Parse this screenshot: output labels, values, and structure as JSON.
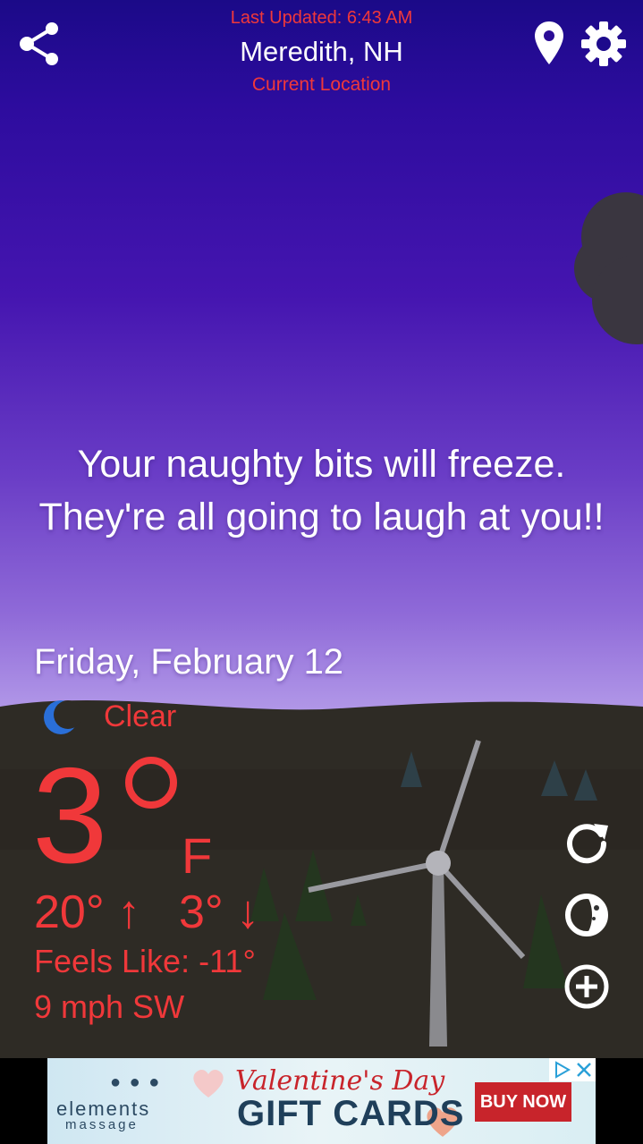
{
  "header": {
    "last_updated": "Last Updated: 6:43 AM",
    "city": "Meredith, NH",
    "location_label": "Current Location"
  },
  "icons": {
    "share": "share-icon",
    "location": "map-pin-icon",
    "settings": "gear-icon",
    "condition": "crescent-moon-icon",
    "refresh": "refresh-icon",
    "radar": "radar-icon",
    "add": "plus-circle-icon"
  },
  "message": "Your naughty bits will freeze. They're all going to laugh at you!!",
  "weather": {
    "date": "Friday, February 12",
    "condition": "Clear",
    "temperature": "3",
    "unit": "F",
    "high": "20° ↑",
    "low": "3° ↓",
    "feels_like": "Feels Like: -11°",
    "wind": "9 mph SW"
  },
  "ad": {
    "brand": "elements",
    "brand_sub": "massage",
    "headline": "Valentine's Day",
    "subheadline": "GIFT CARDS",
    "cta": "BUY NOW"
  },
  "colors": {
    "accent_red": "#f0383a",
    "sky_top": "#1b0a88",
    "sky_bottom": "#b9a2ea",
    "hill": "#2e2a24"
  }
}
